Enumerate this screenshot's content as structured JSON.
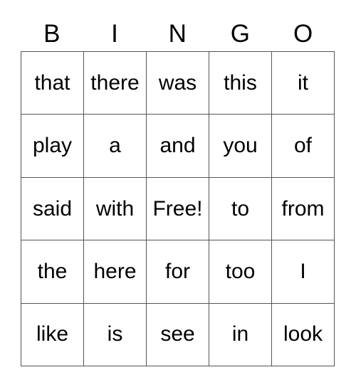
{
  "card": {
    "title": "BINGO",
    "header": {
      "letters": [
        "B",
        "I",
        "N",
        "G",
        "O"
      ]
    },
    "free_space_label": "Free!",
    "free_space_position": {
      "row": 2,
      "col": 2
    },
    "colors": {
      "background": "#ffffff",
      "grid_line": "#555555",
      "text": "#000000"
    },
    "grid": {
      "rows": 5,
      "columns": 5,
      "cells": [
        [
          {
            "text": "that",
            "free": false
          },
          {
            "text": "there",
            "free": false
          },
          {
            "text": "was",
            "free": false
          },
          {
            "text": "this",
            "free": false
          },
          {
            "text": "it",
            "free": false
          }
        ],
        [
          {
            "text": "play",
            "free": false
          },
          {
            "text": "a",
            "free": false
          },
          {
            "text": "and",
            "free": false
          },
          {
            "text": "you",
            "free": false
          },
          {
            "text": "of",
            "free": false
          }
        ],
        [
          {
            "text": "said",
            "free": false
          },
          {
            "text": "with",
            "free": false
          },
          {
            "text": "Free!",
            "free": true
          },
          {
            "text": "to",
            "free": false
          },
          {
            "text": "from",
            "free": false
          }
        ],
        [
          {
            "text": "the",
            "free": false
          },
          {
            "text": "here",
            "free": false
          },
          {
            "text": "for",
            "free": false
          },
          {
            "text": "too",
            "free": false
          },
          {
            "text": "I",
            "free": false
          }
        ],
        [
          {
            "text": "like",
            "free": false
          },
          {
            "text": "is",
            "free": false
          },
          {
            "text": "see",
            "free": false
          },
          {
            "text": "in",
            "free": false
          },
          {
            "text": "look",
            "free": false
          }
        ]
      ]
    }
  }
}
